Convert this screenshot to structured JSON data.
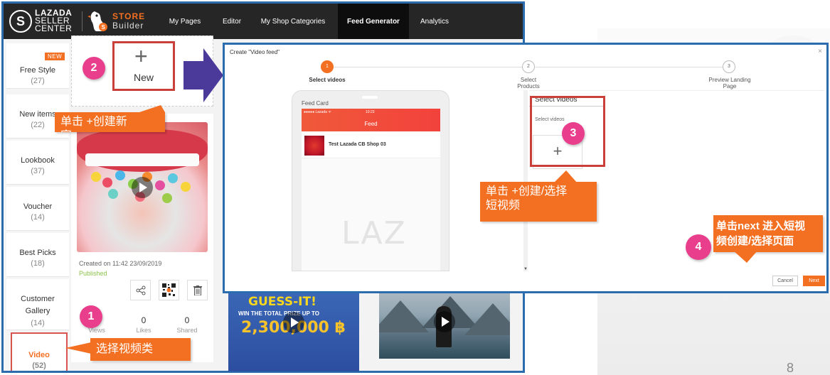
{
  "nav": {
    "lazada_l1": "LAZADA",
    "lazada_l2": "SELLER",
    "lazada_l3": "CENTER",
    "sb_l1": "STORE",
    "sb_l2": "Builder",
    "items": [
      "My Pages",
      "Editor",
      "My Shop Categories",
      "Feed Generator",
      "Analytics"
    ],
    "active": "Feed Generator"
  },
  "sidebar": {
    "new_badge": "NEW",
    "items": [
      {
        "label": "Free Style",
        "count": "(27)"
      },
      {
        "label": "New items",
        "count": "(22)"
      },
      {
        "label": "Lookbook",
        "count": "(37)"
      },
      {
        "label": "Voucher",
        "count": "(14)"
      },
      {
        "label": "Best Picks",
        "count": "(18)"
      },
      {
        "label": "Customer Gallery",
        "count": "(14)"
      },
      {
        "label": "Video",
        "count": "(52)"
      }
    ]
  },
  "new_card": {
    "plus": "+",
    "label": "New"
  },
  "video_card": {
    "created": "Created on 11:42 23/09/2019",
    "status": "Published",
    "stats": [
      {
        "value": "",
        "label": "Views"
      },
      {
        "value": "0",
        "label": "Likes"
      },
      {
        "value": "0",
        "label": "Shared"
      }
    ]
  },
  "bottom_card": {
    "line1": "GUESS-IT!",
    "line2": "WIN THE TOTAL PRIZE UP TO",
    "line3": "2,300,000 ฿"
  },
  "modal": {
    "title": "Create \"Video feed\"",
    "close": "×",
    "steps": [
      {
        "num": "1",
        "label": "Select videos"
      },
      {
        "num": "2",
        "label": "Select Products"
      },
      {
        "num": "3",
        "label": "Preview Landing Page"
      }
    ],
    "phone": {
      "card_label": "Feed Card",
      "carrier": "●●●●● Lazada ᯤ",
      "time": "10:23",
      "screen_title": "Feed",
      "shop_name": "Test Lazada CB Shop 03",
      "watermark": "LAZ"
    },
    "select_videos_title": "Select videos",
    "select_videos_sub": "Select videos",
    "add_symbol": "+",
    "cancel": "Cancel",
    "next": "Next"
  },
  "annotations": {
    "n1": "1",
    "n2": "2",
    "n3": "3",
    "n4": "4",
    "c1": "选择视频类",
    "c2": "单击 +创建新\n容",
    "c3": "单击 +创建/选择\n短视频",
    "c4": "单击next 进入短视\n频创建/选择页面"
  },
  "slide_number": "8",
  "colors": {
    "accent": "#f36f21",
    "frame": "#2a6cae",
    "highlight": "#c9403a",
    "marker": "#e83e8c",
    "arrow": "#4b3a9a"
  }
}
